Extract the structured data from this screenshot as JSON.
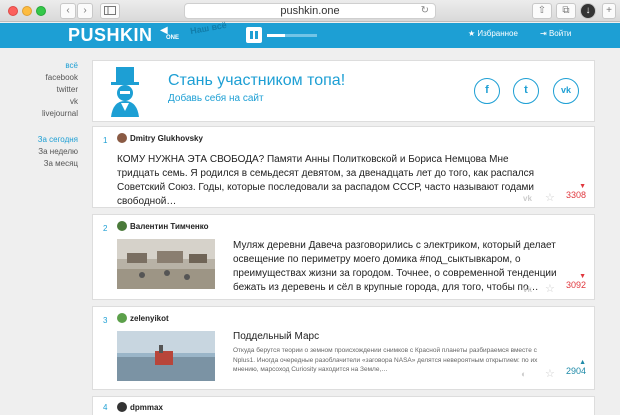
{
  "browser": {
    "url": "pushkin.one",
    "back_glyph": "‹",
    "forward_glyph": "›",
    "reload_glyph": "↻",
    "share_glyph": "⇧",
    "tabs_glyph": "⧉",
    "download_glyph": "↓"
  },
  "header": {
    "logo": "PUSHKIN",
    "logo_suffix": "ONE",
    "overlay": "Наш всё",
    "player_progress": 0.35,
    "favorites_label": "Избранное",
    "login_label": "Войти",
    "accent_color": "#1d9fd4"
  },
  "sidebar": {
    "sources": [
      "всё",
      "facebook",
      "twitter",
      "vk",
      "livejournal"
    ],
    "periods": [
      "За сегодня",
      "За неделю",
      "За месяц"
    ]
  },
  "promo": {
    "title": "Стань участником топа!",
    "subtitle": "Добавь себя на сайт",
    "social": [
      "f",
      "t",
      "vk"
    ]
  },
  "feed": [
    {
      "rank": "1",
      "author": "Dmitry Glukhovsky",
      "text": "КОМУ НУЖНА ЭТА СВОБОДА? Памяти Анны Политковской и Бориса Немцова Мне тридцать семь. Я родился в семьдесят девятом, за двенадцать лет до того, как распался Советский Союз. Годы, которые последовали за распадом СССР, часто называют годами свободной…",
      "votes": "3308",
      "trend": "down"
    },
    {
      "rank": "2",
      "author": "Валентин Тимченко",
      "text": "Муляж деревни Давеча разговорились с электриком, который делает освещение по периметру моего домика #под_сыктывкаром, о преимуществах жизни за городом. Точнее, о современной тенденции бежать из деревень и сёл в крупные города, для того, чтобы по…",
      "votes": "3092",
      "trend": "down"
    },
    {
      "rank": "3",
      "author": "zelenyikot",
      "title": "Поддельный Марс",
      "text": "Откуда берутся теории о земном происхождении снимков с Красной планеты разбираемся вместе с Nplus1. Иногда очередные разоблачители «заговора NASA» делятся невероятным открытием: по их мнению, марсоход Curiosity находится на Земле,…",
      "votes": "2904",
      "trend": "up"
    },
    {
      "rank": "4",
      "author": "dpmmax"
    }
  ]
}
